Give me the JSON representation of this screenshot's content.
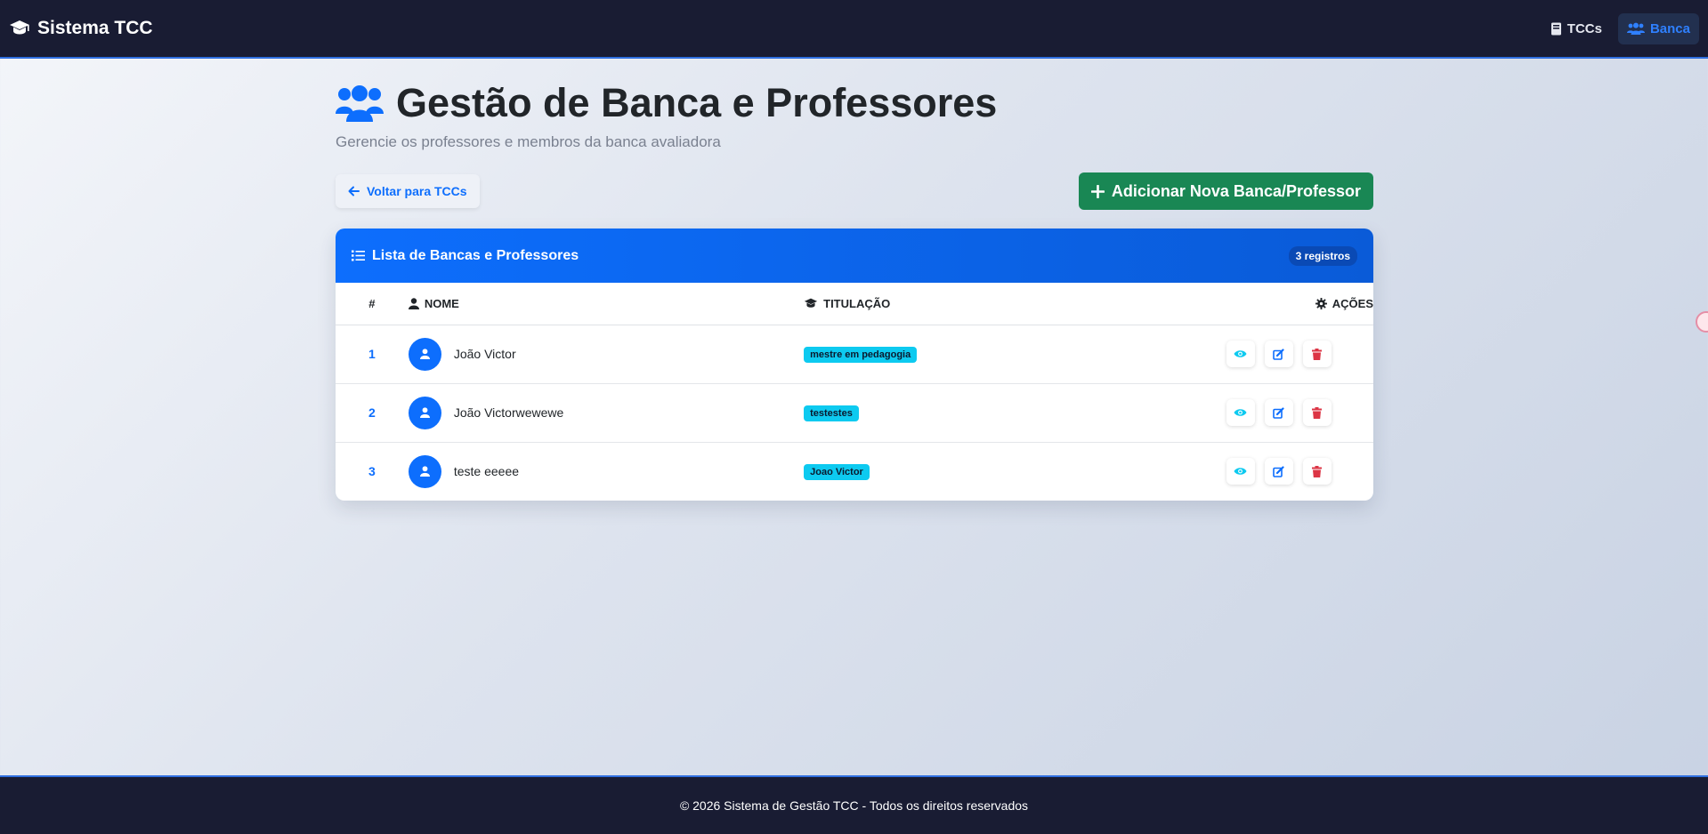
{
  "navbar": {
    "brand": "Sistema TCC",
    "links": [
      {
        "label": "TCCs",
        "icon": "book-icon",
        "active": false
      },
      {
        "label": "Banca",
        "icon": "users-icon",
        "active": true
      }
    ]
  },
  "page": {
    "title": "Gestão de Banca e Professores",
    "subtitle": "Gerencie os professores e membros da banca avaliadora"
  },
  "actions": {
    "back_label": "Voltar para TCCs",
    "add_label": "Adicionar Nova Banca/Professor"
  },
  "card": {
    "title": "Lista de Bancas e Professores",
    "count": "3 registros"
  },
  "table": {
    "headers": {
      "num": "#",
      "nome": "NOME",
      "titulacao": "TITULAÇÃO",
      "acoes": "AÇÕES"
    },
    "rows": [
      {
        "num": "1",
        "nome": "João Victor",
        "titulacao": "mestre em pedagogia"
      },
      {
        "num": "2",
        "nome": "João Victorwewewe",
        "titulacao": "testestes"
      },
      {
        "num": "3",
        "nome": "teste eeeee",
        "titulacao": "Joao Victor"
      }
    ]
  },
  "footer": {
    "text": "© 2026 Sistema de Gestão TCC - Todos os direitos reservados"
  },
  "colors": {
    "primary": "#0d6efd",
    "success": "#198754",
    "info": "#0dcaf0",
    "danger": "#dc3545",
    "navbar": "#191c33"
  }
}
